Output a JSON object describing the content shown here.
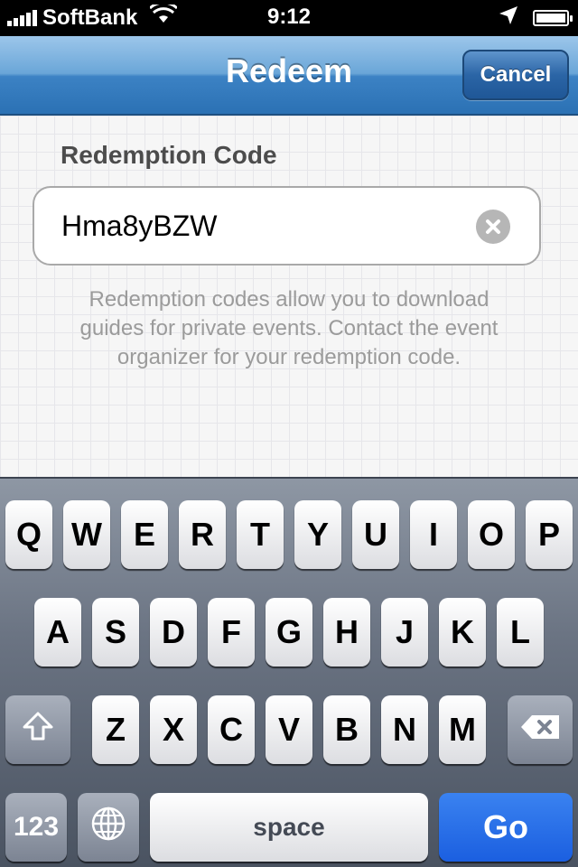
{
  "status_bar": {
    "carrier": "SoftBank",
    "time": "9:12"
  },
  "nav": {
    "title": "Redeem",
    "cancel_label": "Cancel"
  },
  "form": {
    "section_label": "Redemption Code",
    "code_value": "Hma8yBZW",
    "help_text": "Redemption codes allow you to download guides for private events.  Contact the event organizer for your redemption code."
  },
  "keyboard": {
    "row1": [
      "Q",
      "W",
      "E",
      "R",
      "T",
      "Y",
      "U",
      "I",
      "O",
      "P"
    ],
    "row2": [
      "A",
      "S",
      "D",
      "F",
      "G",
      "H",
      "J",
      "K",
      "L"
    ],
    "row3": [
      "Z",
      "X",
      "C",
      "V",
      "B",
      "N",
      "M"
    ],
    "numbers_label": "123",
    "space_label": "space",
    "go_label": "Go"
  },
  "icons": [
    "signal-icon",
    "wifi-icon",
    "location-icon",
    "battery-icon",
    "clear-text-icon",
    "shift-icon",
    "globe-icon",
    "backspace-icon"
  ]
}
